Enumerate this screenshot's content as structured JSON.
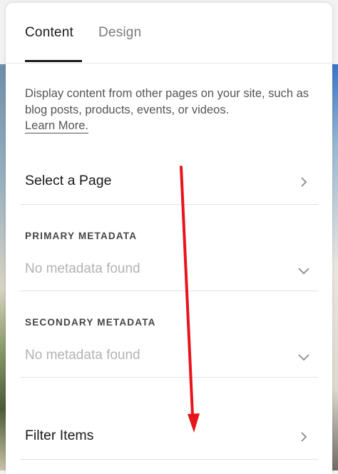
{
  "tabs": [
    {
      "label": "Content",
      "active": true
    },
    {
      "label": "Design",
      "active": false
    }
  ],
  "description": "Display content from other pages on your site, such as blog posts, products, events, or videos.",
  "learn_more": "Learn More.",
  "select_page": {
    "label": "Select a Page",
    "icon": "chevron-right-icon"
  },
  "primary_metadata": {
    "heading": "PRIMARY METADATA",
    "value": "No metadata found",
    "icon": "chevron-down-icon"
  },
  "secondary_metadata": {
    "heading": "SECONDARY METADATA",
    "value": "No metadata found",
    "icon": "chevron-down-icon"
  },
  "filter_items": {
    "label": "Filter Items",
    "icon": "chevron-right-icon"
  },
  "colors": {
    "accent": "#1a1a1a",
    "annotation_arrow": "#e8141c",
    "placeholder": "#b3b3b3"
  }
}
